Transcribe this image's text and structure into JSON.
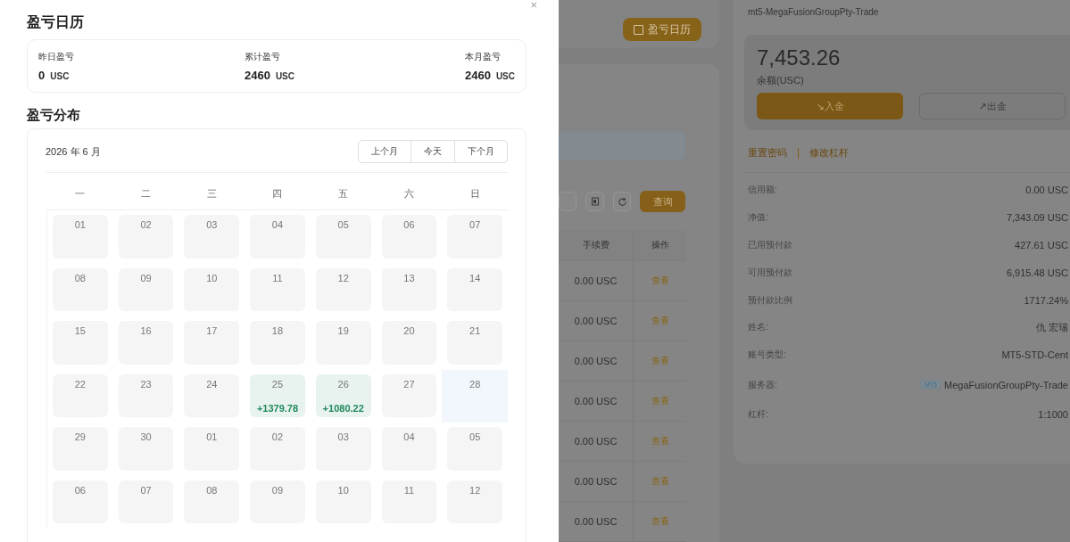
{
  "drawer": {
    "title": "盈亏日历",
    "close": "×",
    "summary": [
      {
        "label": "昨日盈亏",
        "value": "0",
        "unit": "USC"
      },
      {
        "label": "累计盈亏",
        "value": "2460",
        "unit": "USC"
      },
      {
        "label": "本月盈亏",
        "value": "2460",
        "unit": "USC"
      }
    ],
    "section_title": "盈亏分布",
    "calendar": {
      "month": "2026 年 6 月",
      "nav": [
        "上个月",
        "今天",
        "下个月"
      ],
      "weekdays": [
        "一",
        "二",
        "三",
        "四",
        "五",
        "六",
        "日"
      ],
      "days": [
        {
          "day": "01",
          "selected": false
        },
        {
          "day": "02",
          "selected": false
        },
        {
          "day": "03",
          "selected": false
        },
        {
          "day": "04",
          "selected": false
        },
        {
          "day": "05",
          "selected": false
        },
        {
          "day": "06",
          "selected": false
        },
        {
          "day": "07",
          "selected": false
        },
        {
          "day": "08",
          "selected": false
        },
        {
          "day": "09",
          "selected": false
        },
        {
          "day": "10",
          "selected": false
        },
        {
          "day": "11",
          "selected": false
        },
        {
          "day": "12",
          "selected": false
        },
        {
          "day": "13",
          "selected": false
        },
        {
          "day": "14",
          "selected": false
        },
        {
          "day": "15",
          "selected": false
        },
        {
          "day": "16",
          "selected": false
        },
        {
          "day": "17",
          "selected": false
        },
        {
          "day": "18",
          "selected": false
        },
        {
          "day": "19",
          "selected": false
        },
        {
          "day": "20",
          "selected": false
        },
        {
          "day": "21",
          "selected": false
        },
        {
          "day": "22",
          "selected": false
        },
        {
          "day": "23",
          "selected": false
        },
        {
          "day": "24",
          "selected": false
        },
        {
          "day": "25",
          "selected": false,
          "profit": "+1379.78"
        },
        {
          "day": "26",
          "selected": false,
          "profit": "+1080.22"
        },
        {
          "day": "27",
          "selected": false
        },
        {
          "day": "28",
          "selected": true
        },
        {
          "day": "29",
          "selected": false
        },
        {
          "day": "30",
          "selected": false
        },
        {
          "day": "01",
          "selected": false
        },
        {
          "day": "02",
          "selected": false
        },
        {
          "day": "03",
          "selected": false
        },
        {
          "day": "04",
          "selected": false
        },
        {
          "day": "05",
          "selected": false
        },
        {
          "day": "06",
          "selected": false
        },
        {
          "day": "07",
          "selected": false
        },
        {
          "day": "08",
          "selected": false
        },
        {
          "day": "09",
          "selected": false
        },
        {
          "day": "10",
          "selected": false
        },
        {
          "day": "11",
          "selected": false
        },
        {
          "day": "12",
          "selected": false
        }
      ]
    }
  },
  "background": {
    "calendar_button": "盈亏日历",
    "query_button": "查询",
    "table": {
      "columns": [
        "手续费",
        "操作"
      ],
      "rows": [
        {
          "fee": "0.00 USC",
          "action": "查看"
        },
        {
          "fee": "0.00 USC",
          "action": "查看"
        },
        {
          "fee": "0.00 USC",
          "action": "查看"
        },
        {
          "fee": "0.00 USC",
          "action": "查看"
        },
        {
          "fee": "0.00 USC",
          "action": "查看"
        },
        {
          "fee": "0.00 USC",
          "action": "查看"
        },
        {
          "fee": "0.00 USC",
          "action": "查看"
        }
      ]
    },
    "account": {
      "server_line": "mt5-MegaFusionGroupPty-Trade",
      "balance": "7,453.26",
      "balance_label": "余额(USC)",
      "deposit": "↘入金",
      "withdraw": "↗出金",
      "links": [
        "重置密码",
        "修改杠杆"
      ],
      "info": [
        {
          "label": "信用额:",
          "value": "0.00 USC"
        },
        {
          "label": "净值:",
          "value": "7,343.09 USC"
        },
        {
          "label": "已用预付款",
          "value": "427.61 USC"
        },
        {
          "label": "可用预付款",
          "value": "6,915.48 USC"
        },
        {
          "label": "预付款比例",
          "value": "1717.24%"
        },
        {
          "label": "姓名:",
          "value": "仇 宏瑞"
        },
        {
          "label": "账号类型:",
          "value": "MT5-STD-Cent"
        },
        {
          "label": "服务器:",
          "value": "MegaFusionGroupPty-Trade",
          "tag": "MT5"
        },
        {
          "label": "杠杆:",
          "value": "1:1000"
        }
      ]
    }
  }
}
